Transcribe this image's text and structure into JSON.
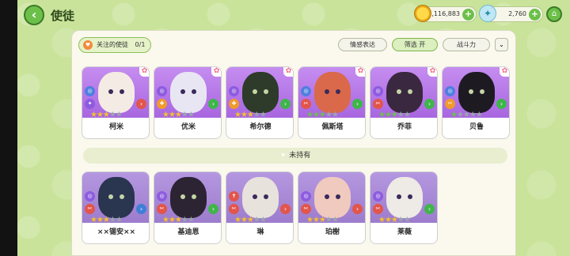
{
  "header": {
    "title": "使徒",
    "gold": "1,116,883",
    "feather": "2,760"
  },
  "filter_bar": {
    "follow_label": "关注的使徒",
    "follow_count": "0/1",
    "tabs": [
      "情感表达",
      "筛选 开",
      "战斗力"
    ]
  },
  "owned": [
    {
      "name": "柯米"
    },
    {
      "name": "优米"
    },
    {
      "name": "希尔德"
    },
    {
      "name": "佩斯塔"
    },
    {
      "name": "乔菲"
    },
    {
      "name": "贝鲁"
    }
  ],
  "divider_label": "未持有",
  "unowned": [
    {
      "name": "××锡安××"
    },
    {
      "name": "基迪恩"
    },
    {
      "name": "琳"
    },
    {
      "name": "珀榭"
    },
    {
      "name": "莱薇"
    }
  ],
  "icons": {
    "back": "chevron-left-icon",
    "home": "home-icon",
    "gold": "gold-coin-icon",
    "feather": "feather-icon",
    "expand": "double-chevron-down-icon",
    "favorite": "flower-icon"
  }
}
